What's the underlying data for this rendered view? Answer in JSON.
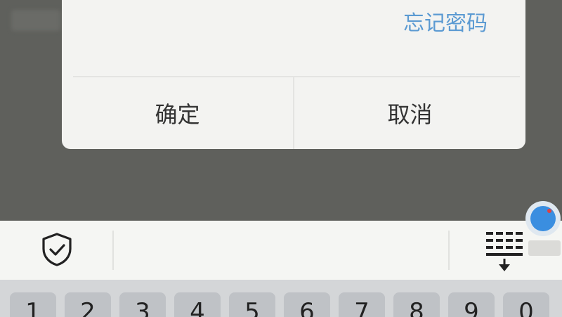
{
  "dialog": {
    "forgot_password": "忘记密码",
    "confirm_label": "确定",
    "cancel_label": "取消"
  },
  "toolbar": {
    "left_icon": "shield-check-icon",
    "right_icon": "keyboard-hide-icon"
  },
  "floating_ball": {
    "icon": "floating-assistant-icon"
  },
  "keyboard": {
    "keys": [
      "1",
      "2",
      "3",
      "4",
      "5",
      "6",
      "7",
      "8",
      "9",
      "0"
    ]
  },
  "colors": {
    "link": "#5b9ad2",
    "overlay": "#5f605c",
    "dialog": "#f3f3f1",
    "accent": "#3a8ee0"
  }
}
